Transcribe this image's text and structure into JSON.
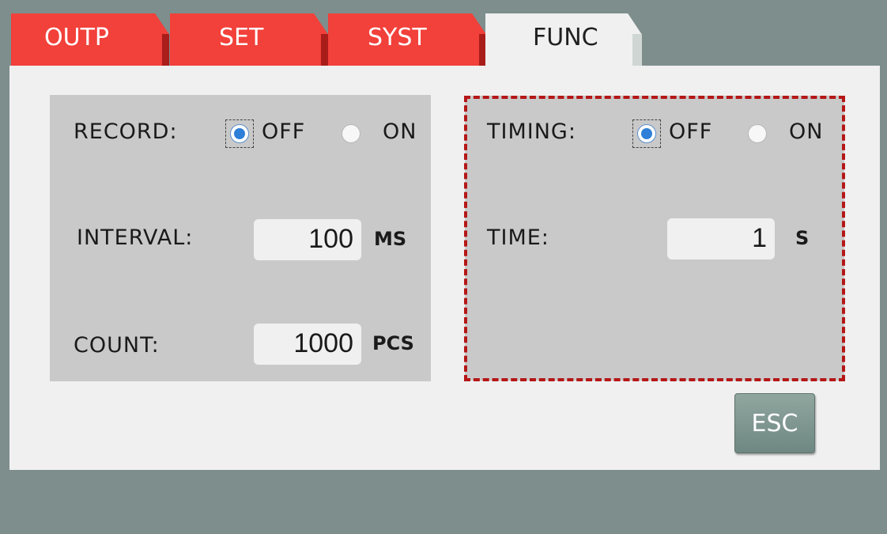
{
  "tabs": [
    {
      "label": "OUTP",
      "active": false
    },
    {
      "label": "SET",
      "active": false
    },
    {
      "label": "SYST",
      "active": false
    },
    {
      "label": "FUNC",
      "active": true
    }
  ],
  "record": {
    "label": "RECORD:",
    "off_label": "OFF",
    "on_label": "ON",
    "selected": "OFF",
    "interval_label": "INTERVAL:",
    "interval_value": "100",
    "interval_unit": "MS",
    "count_label": "COUNT:",
    "count_value": "1000",
    "count_unit": "PCS"
  },
  "timing": {
    "label": "TIMING:",
    "off_label": "OFF",
    "on_label": "ON",
    "selected": "OFF",
    "time_label": "TIME:",
    "time_value": "1",
    "time_unit": "S"
  },
  "esc_label": "ESC",
  "colors": {
    "background": "#7e8e8c",
    "tab_red": "#f2403a",
    "panel": "#f0f0f0",
    "box": "#c9c9c9",
    "radio_selected": "#2f7fd8",
    "highlight_border": "#b51717"
  }
}
